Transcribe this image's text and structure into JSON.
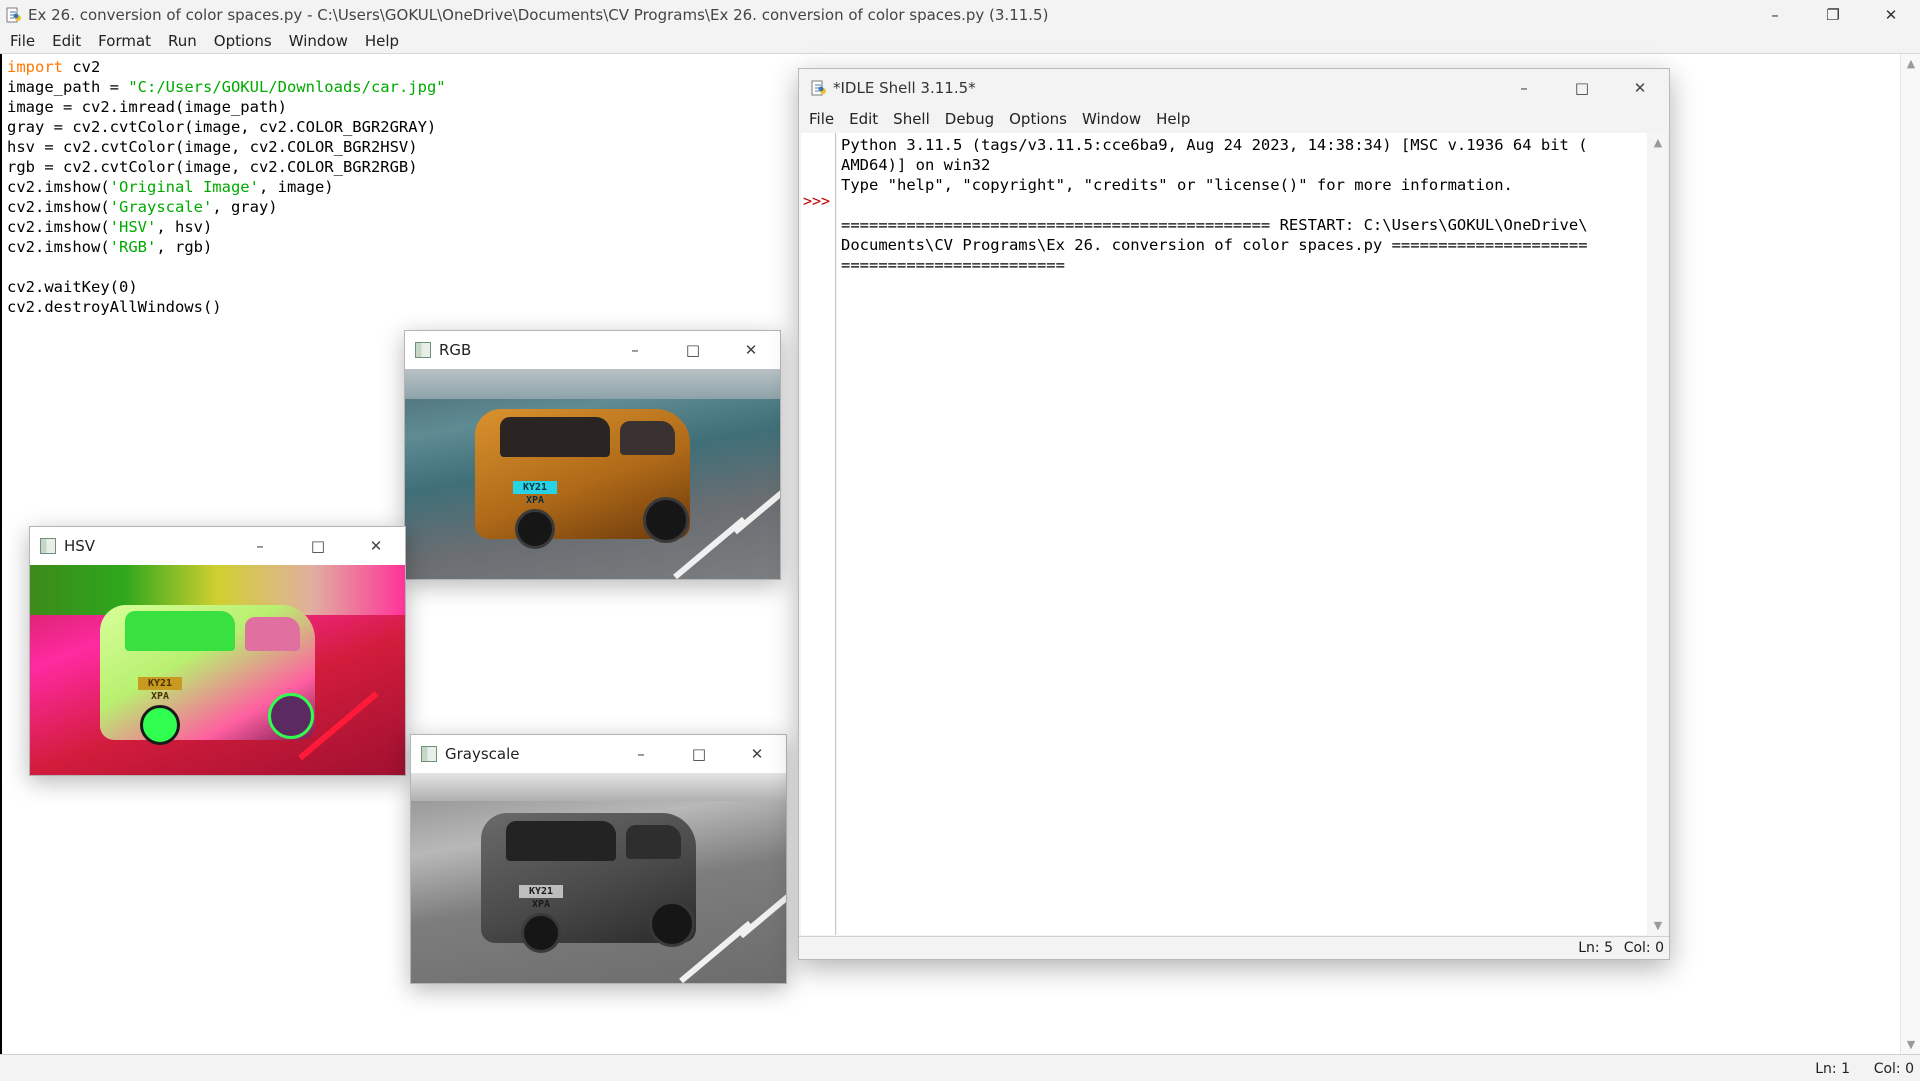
{
  "main_window": {
    "title": "Ex 26. conversion of color spaces.py - C:\\Users\\GOKUL\\OneDrive\\Documents\\CV Programs\\Ex 26. conversion of color spaces.py (3.11.5)",
    "menu": [
      "File",
      "Edit",
      "Format",
      "Run",
      "Options",
      "Window",
      "Help"
    ],
    "status": {
      "ln": "Ln: 1",
      "col": "Col: 0"
    }
  },
  "code_lines": [
    [
      {
        "t": "import",
        "c": "kw"
      },
      {
        "t": " cv2",
        "c": ""
      }
    ],
    [
      {
        "t": "image_path = ",
        "c": ""
      },
      {
        "t": "\"C:/Users/GOKUL/Downloads/car.jpg\"",
        "c": "str"
      }
    ],
    [
      {
        "t": "image = cv2.imread(image_path)",
        "c": ""
      }
    ],
    [
      {
        "t": "gray = cv2.cvtColor(image, cv2.COLOR_BGR2GRAY)",
        "c": ""
      }
    ],
    [
      {
        "t": "hsv = cv2.cvtColor(image, cv2.COLOR_BGR2HSV)",
        "c": ""
      }
    ],
    [
      {
        "t": "rgb = cv2.cvtColor(image, cv2.COLOR_BGR2RGB)",
        "c": ""
      }
    ],
    [
      {
        "t": "cv2.imshow(",
        "c": ""
      },
      {
        "t": "'Original Image'",
        "c": "str"
      },
      {
        "t": ", image)",
        "c": ""
      }
    ],
    [
      {
        "t": "cv2.imshow(",
        "c": ""
      },
      {
        "t": "'Grayscale'",
        "c": "str"
      },
      {
        "t": ", gray)",
        "c": ""
      }
    ],
    [
      {
        "t": "cv2.imshow(",
        "c": ""
      },
      {
        "t": "'HSV'",
        "c": "str"
      },
      {
        "t": ", hsv)",
        "c": ""
      }
    ],
    [
      {
        "t": "cv2.imshow(",
        "c": ""
      },
      {
        "t": "'RGB'",
        "c": "str"
      },
      {
        "t": ", rgb)",
        "c": ""
      }
    ],
    [
      {
        "t": "",
        "c": ""
      }
    ],
    [
      {
        "t": "cv2.waitKey(0)",
        "c": ""
      }
    ],
    [
      {
        "t": "cv2.destroyAllWindows()",
        "c": ""
      }
    ]
  ],
  "image_windows": {
    "rgb": {
      "title": "RGB",
      "plate": "KY21 XPA"
    },
    "hsv": {
      "title": "HSV",
      "plate": "KY21 XPA"
    },
    "gray": {
      "title": "Grayscale",
      "plate": "KY21 XPA"
    }
  },
  "shell": {
    "title": "*IDLE Shell 3.11.5*",
    "menu": [
      "File",
      "Edit",
      "Shell",
      "Debug",
      "Options",
      "Window",
      "Help"
    ],
    "prompt": ">>>",
    "output": "Python 3.11.5 (tags/v3.11.5:cce6ba9, Aug 24 2023, 14:38:34) [MSC v.1936 64 bit (\nAMD64)] on win32\nType \"help\", \"copyright\", \"credits\" or \"license()\" for more information.\n\n============================================== RESTART: C:\\Users\\GOKUL\\OneDrive\\\nDocuments\\CV Programs\\Ex 26. conversion of color spaces.py =====================\n========================",
    "status": {
      "ln": "Ln: 5",
      "col": "Col: 0"
    }
  },
  "icons": {
    "minimize": "–",
    "maximize": "□",
    "restore": "❐",
    "close": "✕",
    "scroll_up": "▲",
    "scroll_down": "▼"
  },
  "colors": {
    "keyword": "#ff7700",
    "string": "#00aa00",
    "prompt": "#c00000"
  }
}
